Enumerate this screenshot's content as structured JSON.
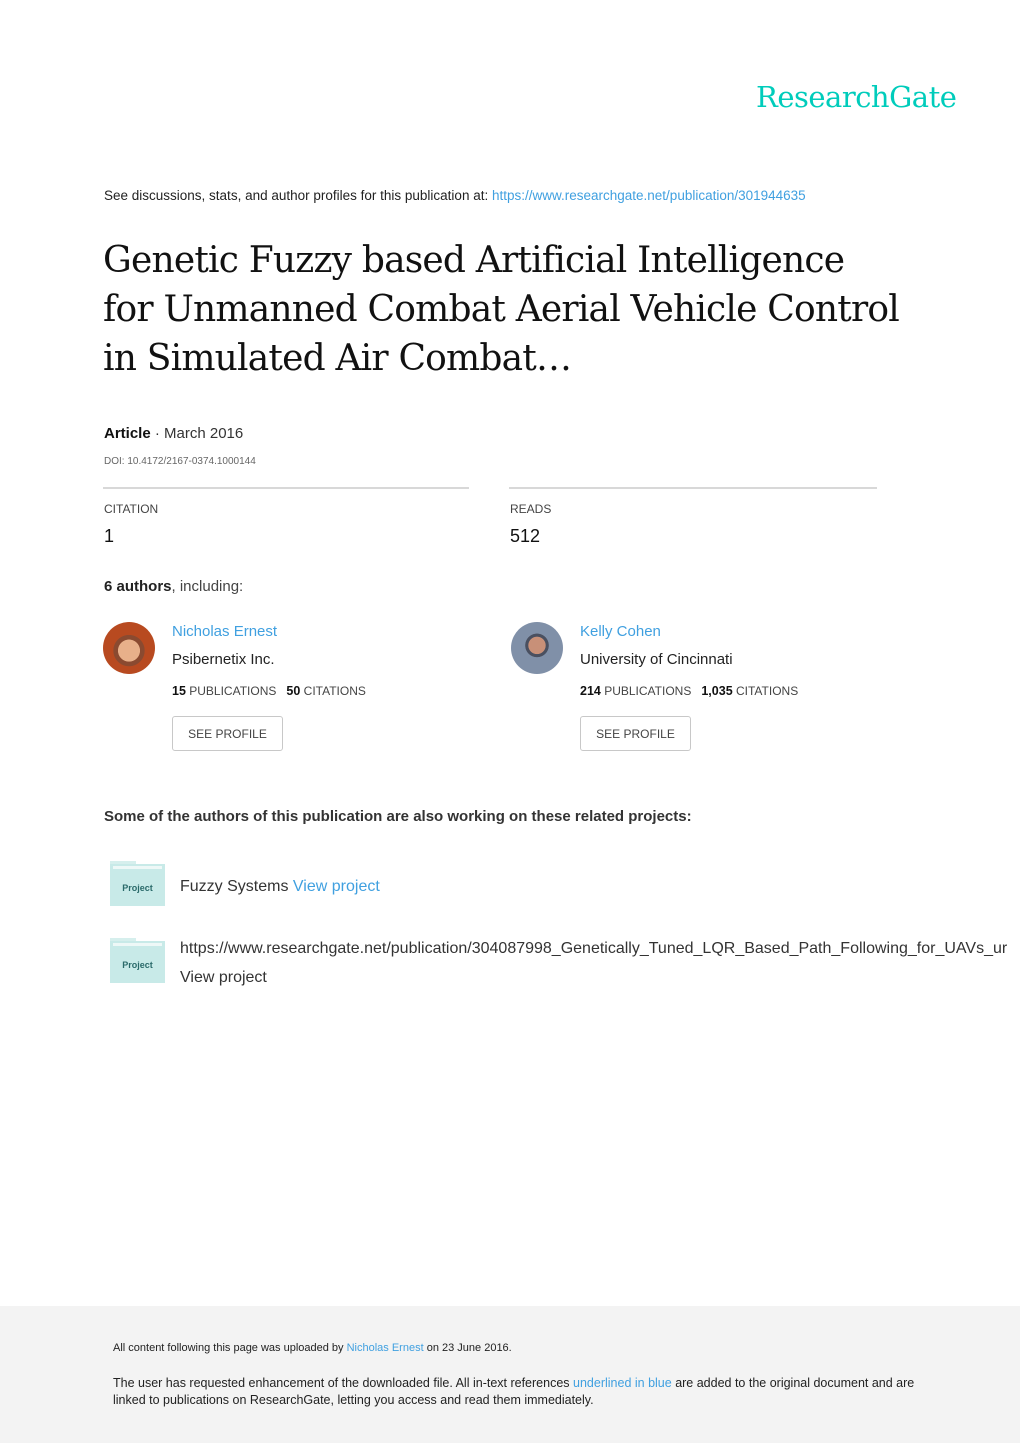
{
  "brand": {
    "logo_text": "ResearchGate",
    "accent_color": "#00ccbb",
    "link_color": "#40a0e0"
  },
  "header": {
    "see_discussions_text": "See discussions, stats, and author profiles for this publication at: ",
    "publication_url": "https://www.researchgate.net/publication/301944635"
  },
  "publication": {
    "title": "Genetic Fuzzy based Artificial Intelligence for Unmanned Combat Aerial Vehicle Control in Simulated Air Combat…",
    "type": "Article",
    "separator": " · ",
    "date": "March 2016",
    "doi": "DOI: 10.4172/2167-0374.1000144"
  },
  "stats": {
    "citation_label": "CITATION",
    "citation_value": "1",
    "reads_label": "READS",
    "reads_value": "512"
  },
  "authors_section": {
    "count_bold": "6 authors",
    "count_rest": ", including:",
    "authors": [
      {
        "name": "Nicholas Ernest",
        "institution": "Psibernetix Inc.",
        "publications": "15",
        "publications_label": "PUBLICATIONS",
        "citations": "50",
        "citations_label": "CITATIONS",
        "button_label": "SEE PROFILE"
      },
      {
        "name": "Kelly Cohen",
        "institution": "University of Cincinnati",
        "publications": "214",
        "publications_label": "PUBLICATIONS",
        "citations": "1,035",
        "citations_label": "CITATIONS",
        "button_label": "SEE PROFILE"
      }
    ]
  },
  "related_projects": {
    "heading": "Some of the authors of this publication are also working on these related projects:",
    "icon_label": "Project",
    "items": [
      {
        "title": "Fuzzy Systems",
        "link_label": "View project"
      },
      {
        "title": "https://www.researchgate.net/publication/304087998_Genetically_Tuned_LQR_Based_Path_Following_for_UAVs_ur",
        "link_label": "View project"
      }
    ]
  },
  "footer": {
    "uploaded_prefix": "All content following this page was uploaded by ",
    "uploader": "Nicholas Ernest",
    "uploaded_suffix": " on 23 June 2016.",
    "enhancement_prefix": "The user has requested enhancement of the downloaded file. All in-text references ",
    "enhancement_link": "underlined in blue",
    "enhancement_suffix": " are added to the original document and are linked to publications on ResearchGate, letting you access and read them immediately."
  }
}
